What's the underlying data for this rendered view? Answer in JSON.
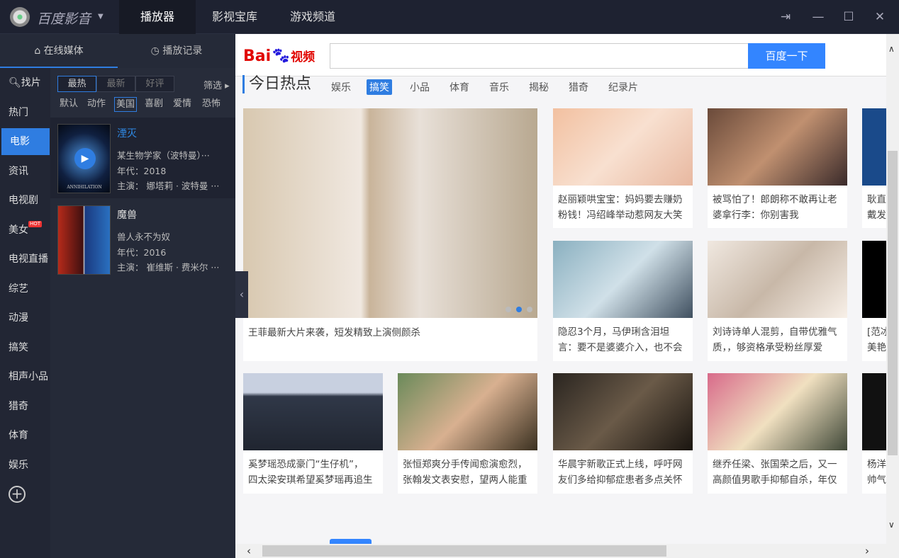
{
  "app": {
    "name": "百度影音"
  },
  "top_tabs": [
    {
      "label": "播放器",
      "active": true
    },
    {
      "label": "影视宝库"
    },
    {
      "label": "游戏频道"
    }
  ],
  "window": {
    "pin": "⇥",
    "minimize": "—",
    "maximize": "☐",
    "close": "✕"
  },
  "side_tabs": [
    {
      "label": "在线媒体",
      "icon": "home-icon",
      "active": true
    },
    {
      "label": "播放记录",
      "icon": "clock-icon"
    }
  ],
  "nav": {
    "search_label": "找片",
    "items": [
      "热门",
      "电影",
      "资讯",
      "电视剧",
      "美女",
      "电视直播",
      "综艺",
      "动漫",
      "搞笑",
      "相声小品",
      "猎奇",
      "体育",
      "娱乐"
    ],
    "active": "电影",
    "hot_badge": "HOT"
  },
  "filters": {
    "sort": [
      "最热",
      "最新",
      "好评"
    ],
    "active_sort": "最热",
    "screen": "筛选",
    "genres": [
      "默认",
      "动作",
      "美国",
      "喜剧",
      "爱情",
      "恐怖"
    ],
    "active_genre": "美国"
  },
  "movies": [
    {
      "title": "湮灭",
      "desc": "某生物学家（波特曼）···",
      "year": "年代：2018",
      "cast": "主演：  娜塔莉 · 波特曼 ···",
      "poster_text": "ANNIHILATION"
    },
    {
      "title": "魔兽",
      "desc": "兽人永不为奴",
      "year": "年代：2016",
      "cast": "主演：  崔维斯 · 费米尔 ···"
    }
  ],
  "browser": {
    "logo": "Bai du 视频",
    "search_value": "",
    "search_button": "百度一下"
  },
  "hot": {
    "title": "今日热点",
    "categories": [
      "娱乐",
      "搞笑",
      "小品",
      "体育",
      "音乐",
      "揭秘",
      "猎奇",
      "纪录片"
    ],
    "active": "搞笑"
  },
  "featured": {
    "caption": "王菲最新大片来袭，短发精致上演侧颜杀",
    "slide": 2,
    "slides": 3
  },
  "cards_r1": [
    {
      "l1": "赵丽颖哄宝宝：妈妈要去赚奶",
      "l2": "粉钱！冯绍峰举动惹网友大笑"
    },
    {
      "l1": "被骂怕了！郎朗称不敢再让老",
      "l2": "婆拿行李：你别害我"
    },
    {
      "l1": "耿直",
      "l2": "戴发"
    }
  ],
  "cards_r2": [
    {
      "l1": "隐忍3个月，马伊琍含泪坦",
      "l2": "言：要不是婆婆介入，也不会"
    },
    {
      "l1": "刘诗诗单人混剪，自带优雅气",
      "l2": "质，，够资格承受粉丝厚爱"
    },
    {
      "l1": "[范冰",
      "l2": "美艳"
    }
  ],
  "cards_r3": [
    {
      "l1": "奚梦瑶恐成豪门“生仔机”，",
      "l2": "四太梁安琪希望奚梦瑶再追生"
    },
    {
      "l1": "张恒郑爽分手传闻愈演愈烈，",
      "l2": "张翰发文表安慰，望两人能重"
    },
    {
      "l1": "华晨宇新歌正式上线，呼吁网",
      "l2": "友们多给抑郁症患者多点关怀"
    },
    {
      "l1": "继乔任梁、张国荣之后，又一",
      "l2": "高颜值男歌手抑郁自杀，年仅"
    },
    {
      "l1": "杨洋",
      "l2": "帅气"
    }
  ],
  "colors": {
    "accent": "#2f7de1",
    "baidu_red": "#e10601",
    "baidu_blue": "#2319dc",
    "search_btn": "#3385ff"
  }
}
